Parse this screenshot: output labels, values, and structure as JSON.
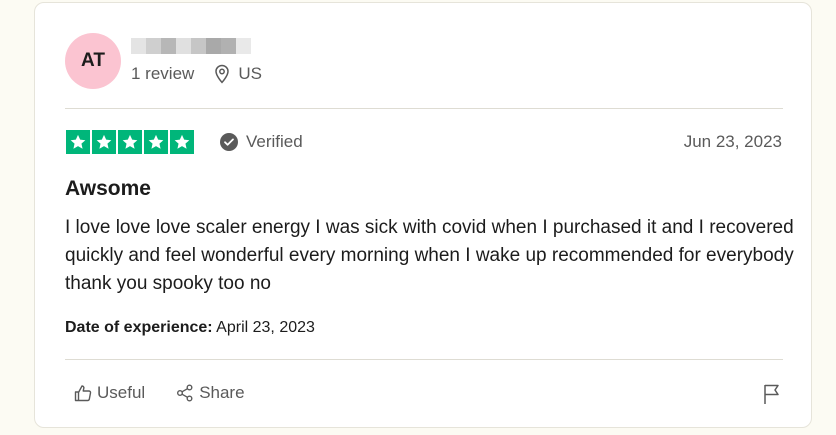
{
  "reviewer": {
    "initials": "AT",
    "review_count": "1 review",
    "location": "US",
    "avatar_color": "#fbc4d1"
  },
  "review": {
    "rating": 5,
    "verified_label": "Verified",
    "date": "Jun 23, 2023",
    "title": "Awsome",
    "text": "I love love love scaler energy I was sick with covid when I purchased it and I recovered quickly and feel wonderful every morning when I wake up recommended for everybody thank you spooky too no",
    "experience_label": "Date of experience:",
    "experience_date": "April 23, 2023"
  },
  "actions": {
    "useful_label": "Useful",
    "share_label": "Share"
  },
  "colors": {
    "star_green": "#00b67a",
    "muted_text": "#5a5a5a"
  },
  "icons": {
    "location": "location-pin-icon",
    "verified": "check-circle-icon",
    "useful": "thumbs-up-icon",
    "share": "share-icon",
    "flag": "flag-icon"
  }
}
